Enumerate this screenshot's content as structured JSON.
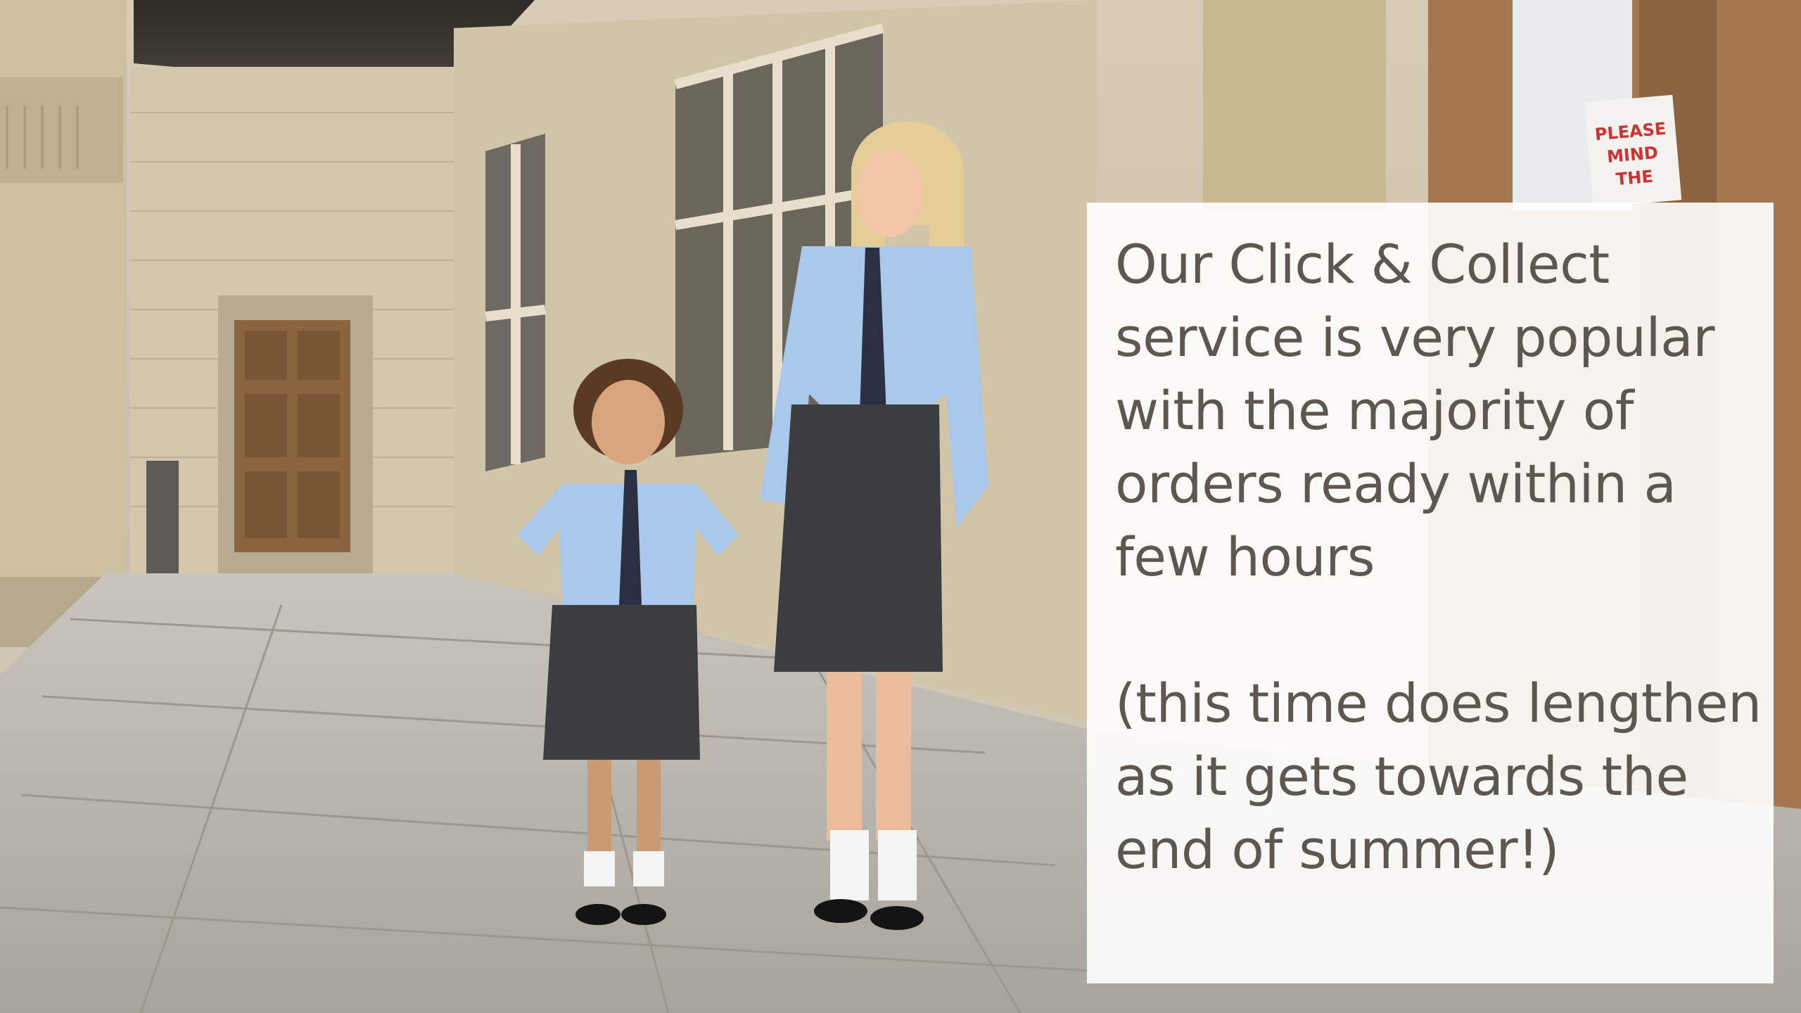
{
  "slide": {
    "lines": [
      "Our Click & Collect",
      "service is very popular",
      "with the majority of",
      "orders ready within a",
      "few hours",
      "(this time does lengthen",
      "as it gets towards the",
      "end of summer!)"
    ]
  },
  "scene": {
    "sign_lines": [
      "PLEASE",
      "MIND",
      "THE"
    ],
    "colors": {
      "stone": "#cfc4ab",
      "floor": "#bfbab2",
      "door": "#8a6440",
      "shirt": "#a9c8ea",
      "skirt": "#3c3d41",
      "text": "#5d5750"
    }
  }
}
